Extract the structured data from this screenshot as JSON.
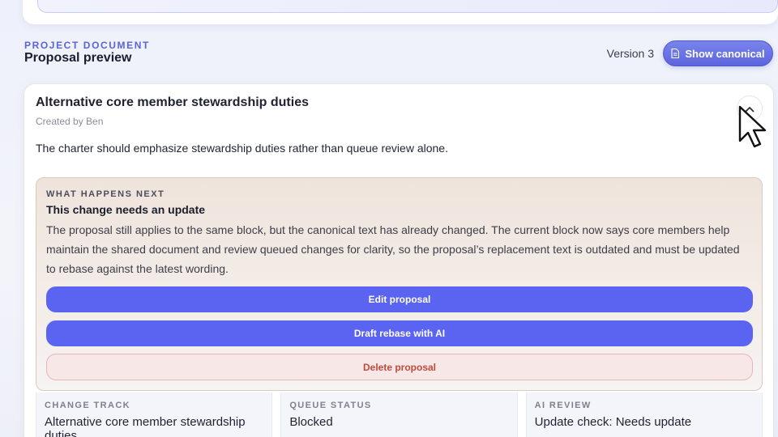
{
  "header": {
    "eyebrow": "PROJECT DOCUMENT",
    "title": "Proposal preview",
    "version": "Version 3",
    "show_canonical_label": "Show canonical"
  },
  "proposal": {
    "title": "Alternative core member stewardship duties",
    "author": "Created by Ben",
    "body": "The charter should emphasize stewardship duties rather than queue review alone."
  },
  "next": {
    "eyebrow": "WHAT HAPPENS NEXT",
    "title": "This change needs an update",
    "description": "The proposal still applies to the same block, but the canonical text has already changed. The current block now says core members help maintain the shared document and review queued changes for clarity, so the proposal’s replacement text is outdated and must be updated to rebase against the latest wording.",
    "edit_label": "Edit proposal",
    "draft_label": "Draft rebase with AI",
    "delete_label": "Delete proposal"
  },
  "stats": [
    {
      "label": "CHANGE TRACK",
      "value": "Alternative core member stewardship duties"
    },
    {
      "label": "QUEUE STATUS",
      "value": "Blocked"
    },
    {
      "label": "AI REVIEW",
      "value": "Update check: Needs update"
    }
  ],
  "colors": {
    "accent": "#5b63f1",
    "danger": "#c04a3e"
  },
  "icons": {
    "show_canonical": "document-icon",
    "collapse": "chevron-up-icon"
  }
}
